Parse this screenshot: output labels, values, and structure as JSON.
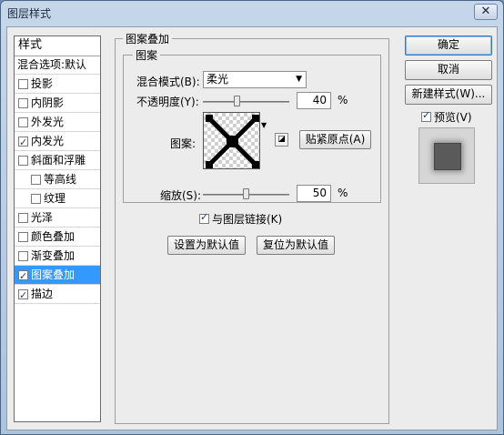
{
  "window": {
    "title": "图层样式",
    "close_glyph": "✕"
  },
  "style_list": {
    "header": "样式",
    "default_item": "混合选项:默认",
    "items": [
      {
        "label": "投影",
        "checked": false,
        "sub": false,
        "selected": false
      },
      {
        "label": "内阴影",
        "checked": false,
        "sub": false,
        "selected": false
      },
      {
        "label": "外发光",
        "checked": false,
        "sub": false,
        "selected": false
      },
      {
        "label": "内发光",
        "checked": true,
        "sub": false,
        "selected": false
      },
      {
        "label": "斜面和浮雕",
        "checked": false,
        "sub": false,
        "selected": false
      },
      {
        "label": "等高线",
        "checked": false,
        "sub": true,
        "selected": false
      },
      {
        "label": "纹理",
        "checked": false,
        "sub": true,
        "selected": false
      },
      {
        "label": "光泽",
        "checked": false,
        "sub": false,
        "selected": false
      },
      {
        "label": "颜色叠加",
        "checked": false,
        "sub": false,
        "selected": false
      },
      {
        "label": "渐变叠加",
        "checked": false,
        "sub": false,
        "selected": false
      },
      {
        "label": "图案叠加",
        "checked": true,
        "sub": false,
        "selected": true
      },
      {
        "label": "描边",
        "checked": true,
        "sub": false,
        "selected": false
      }
    ]
  },
  "panel": {
    "section_title": "图案叠加",
    "group_title": "图案",
    "blend_mode_label": "混合模式(B):",
    "blend_mode_value": "柔光",
    "opacity_label": "不透明度(Y):",
    "opacity_value": "40",
    "opacity_percent": 40,
    "pattern_label": "图案:",
    "snap_origin_button": "贴紧原点(A)",
    "scale_label": "缩放(S):",
    "scale_value": "50",
    "scale_percent": 50,
    "percent_sign": "%",
    "link_with_layer_label": "与图层链接(K)",
    "link_with_layer_checked": true,
    "make_default_button": "设置为默认值",
    "reset_default_button": "复位为默认值"
  },
  "right_panel": {
    "ok_button": "确定",
    "cancel_button": "取消",
    "new_style_button": "新建样式(W)...",
    "preview_label": "预览(V)",
    "preview_checked": true
  }
}
